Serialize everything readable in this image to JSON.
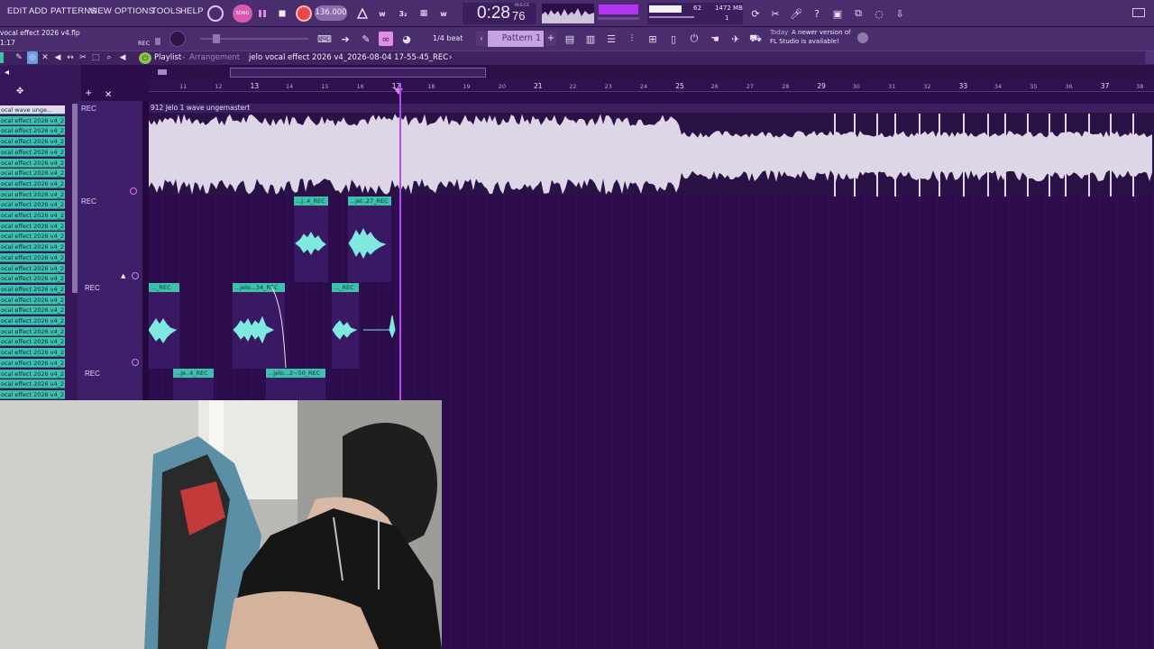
{
  "menu": [
    "EDIT",
    "ADD",
    "PATTERNS",
    "VIEW",
    "OPTIONS",
    "TOOLS",
    "HELP"
  ],
  "transport": {
    "song_label": "SONG",
    "bpm": "136.000",
    "time": "0:28",
    "time_frac": "76",
    "time_unit": "M:S:CS"
  },
  "monitor": {
    "cpu": "62",
    "ram": "1472 MB",
    "voices": "1"
  },
  "project": {
    "file": "vocal effect 2026 v4.flp",
    "line2": "1:17",
    "rec_label": "REC"
  },
  "snap": {
    "value": "1/4 beat"
  },
  "pattern": {
    "label": "Pattern 1"
  },
  "news": {
    "day": "Today",
    "text1": "A newer version of",
    "text2": "FL Studio is available!"
  },
  "playlist": {
    "title": "Playlist",
    "mode": "Arrangement",
    "breadcrumb": "jelo vocal effect 2026 v4_2026-08-04 17-55-45_REC",
    "breadcrumb_arrow": "›"
  },
  "ruler_ticks": [
    "11",
    "12",
    "13",
    "14",
    "15",
    "16",
    "17",
    "18",
    "19",
    "20",
    "21",
    "22",
    "23",
    "24",
    "25",
    "26",
    "27",
    "28",
    "29",
    "30",
    "31",
    "32",
    "33",
    "34",
    "35",
    "36",
    "37",
    "38"
  ],
  "picker": {
    "first": "ocal wave unge...",
    "items_label": "ocal effect 2026 v4_2",
    "count": 28
  },
  "tracks": [
    {
      "label": "REC"
    },
    {
      "label": "REC"
    },
    {
      "label": "REC"
    },
    {
      "label": "REC"
    }
  ],
  "clips": {
    "main": "912 Jelo 1 wave ungemastert",
    "c1": "...j..4_REC",
    "c2": "...jel..27_REC",
    "c3": "..._REC",
    "c4": "...jelo...34_REC",
    "c5": "..._REC",
    "c6": "...je..4_REC",
    "c7": "...jelo...2~50_REC"
  }
}
